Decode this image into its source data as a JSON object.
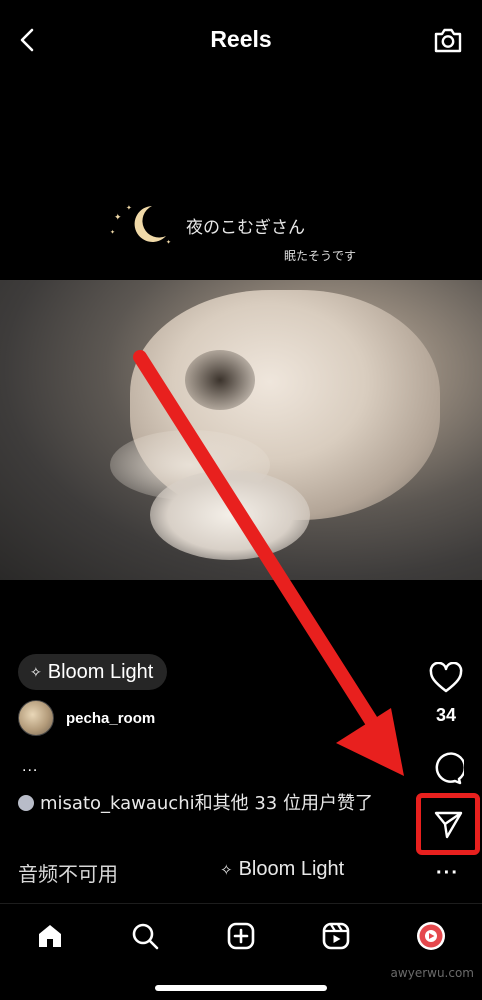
{
  "header": {
    "title": "Reels"
  },
  "video_overlay": {
    "line1": "夜のこむぎさん",
    "line2": "眠たそうです"
  },
  "reel": {
    "effect_label": "Bloom Light",
    "username": "pecha_room",
    "caption_more": "...",
    "likes_text": "misato_kawauchi和其他 33 位用户赞了",
    "audio_status": "音频不可用",
    "audio_effect": "Bloom Light"
  },
  "actions": {
    "like_count": "34",
    "more": "···"
  },
  "tabs": [
    "home",
    "search",
    "create",
    "reels",
    "profile"
  ],
  "watermark": "awyerwu.com",
  "colors": {
    "background": "#000000",
    "annotation": "#e8201e",
    "text": "#ffffff"
  }
}
